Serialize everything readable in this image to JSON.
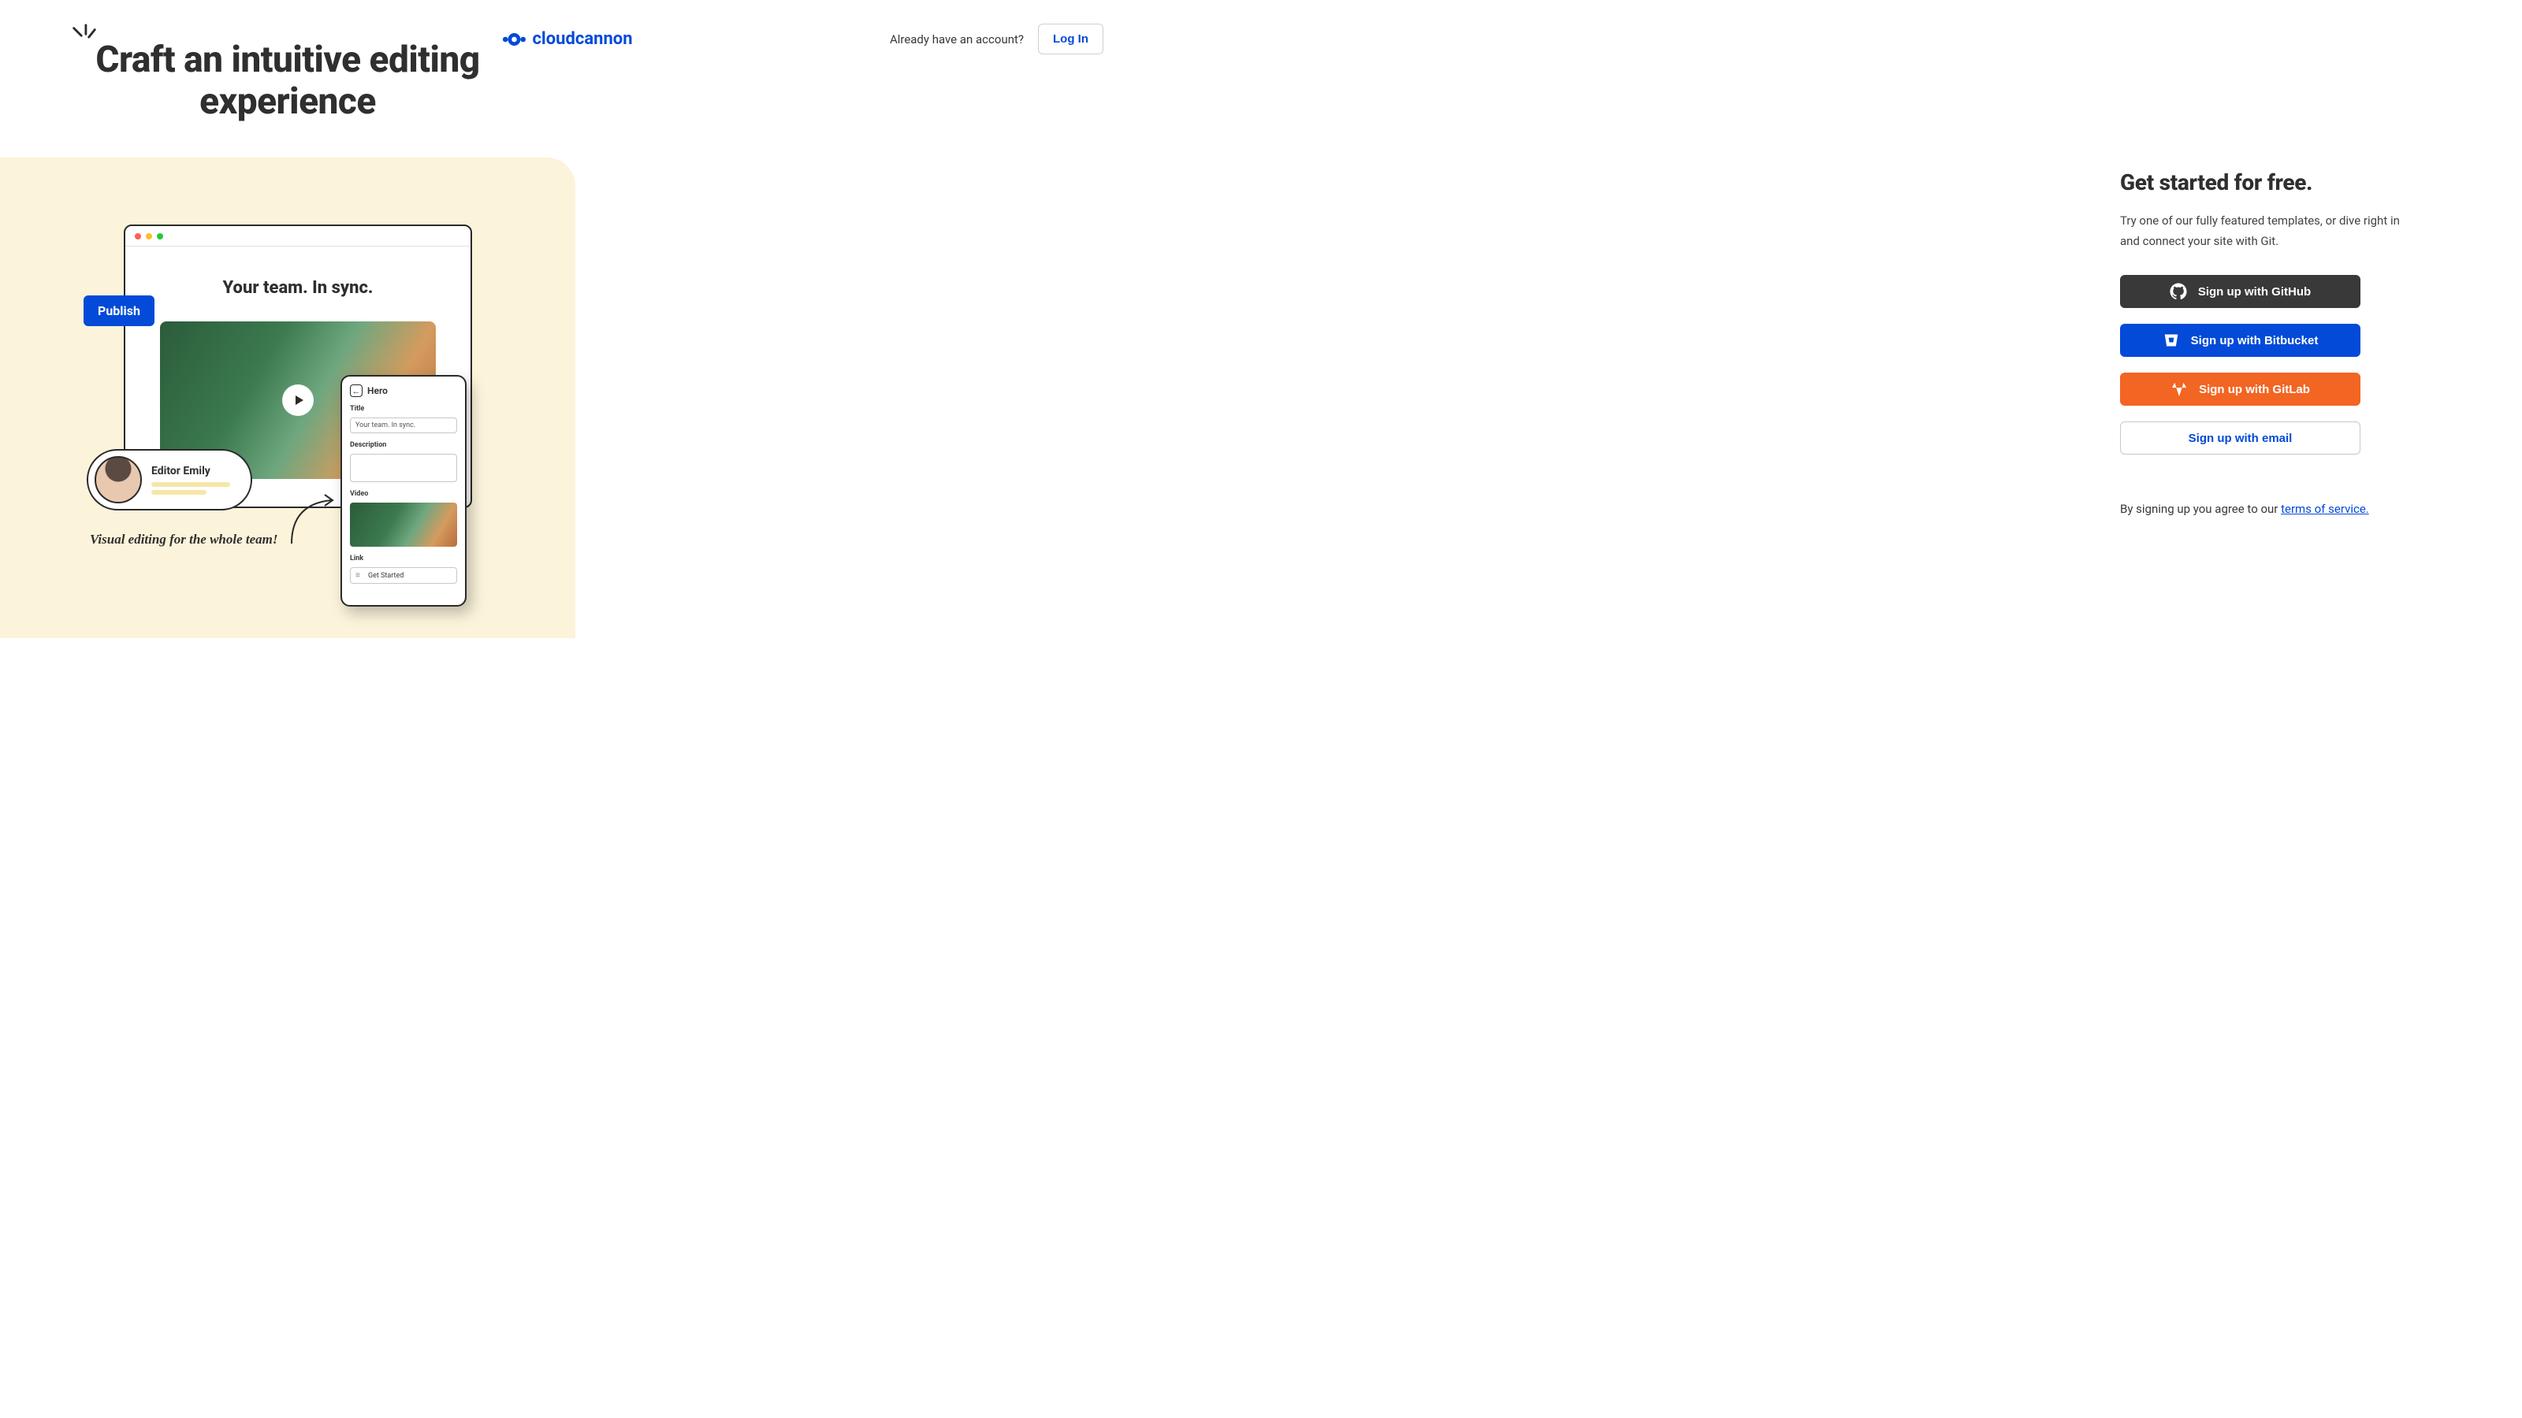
{
  "brand": {
    "name": "cloudcannon"
  },
  "header": {
    "already_account": "Already have an account?",
    "login": "Log In"
  },
  "hero": {
    "title": "Craft an intuitive editing experience",
    "browser_heading": "Your team. In sync.",
    "publish_badge": "Publish",
    "editor_name": "Editor Emily",
    "handwritten": "Visual editing for the whole team!"
  },
  "mobile_editor": {
    "panel_title": "Hero",
    "fields": {
      "title_label": "Title",
      "title_value": "Your team. In sync.",
      "description_label": "Description",
      "video_label": "Video",
      "link_label": "Link",
      "link_value": "Get Started"
    }
  },
  "signup": {
    "heading": "Get started for free.",
    "description": "Try one of our fully featured templates, or dive right in and connect your site with Git.",
    "github": "Sign up with GitHub",
    "bitbucket": "Sign up with Bitbucket",
    "gitlab": "Sign up with GitLab",
    "email": "Sign up with email",
    "tos_prefix": "By signing up you agree to our ",
    "tos_link": "terms of service."
  },
  "colors": {
    "blue": "#034ad8",
    "orange": "#f26522",
    "dark": "#393939",
    "cream": "#fbf3da"
  }
}
